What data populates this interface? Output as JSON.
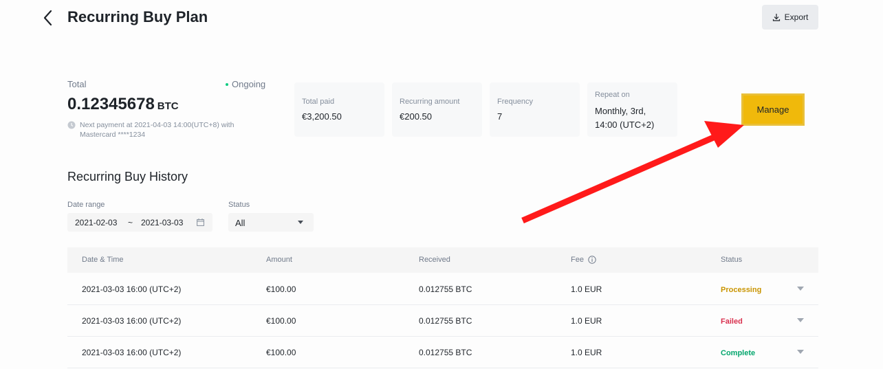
{
  "header": {
    "title": "Recurring Buy Plan",
    "export_label": "Export"
  },
  "plan": {
    "total_label": "Total",
    "status_label": "Ongoing",
    "amount": "0.12345678",
    "unit": "BTC",
    "next_payment": "Next payment at 2021-04-03 14:00(UTC+8) with Mastercard ****1234"
  },
  "cards": [
    {
      "label": "Total paid",
      "value": "€3,200.50"
    },
    {
      "label": "Recurring amount",
      "value": "€200.50"
    },
    {
      "label": "Frequency",
      "value": "7"
    },
    {
      "label": "Repeat on",
      "value": "Monthly, 3rd, 14:00 (UTC+2)"
    }
  ],
  "manage_label": "Manage",
  "history": {
    "title": "Recurring Buy History",
    "date_range_label": "Date range",
    "date_from": "2021-02-03",
    "date_sep": "~",
    "date_to": "2021-03-03",
    "status_label": "Status",
    "status_value": "All"
  },
  "table": {
    "columns": [
      "Date & Time",
      "Amount",
      "Received",
      "Fee",
      "Status"
    ],
    "rows": [
      {
        "datetime": "2021-03-03 16:00 (UTC+2)",
        "amount": "€100.00",
        "received": "0.012755 BTC",
        "fee": "1.0 EUR",
        "status": "Processing"
      },
      {
        "datetime": "2021-03-03 16:00 (UTC+2)",
        "amount": "€100.00",
        "received": "0.012755 BTC",
        "fee": "1.0 EUR",
        "status": "Failed"
      },
      {
        "datetime": "2021-03-03 16:00 (UTC+2)",
        "amount": "€100.00",
        "received": "0.012755 BTC",
        "fee": "1.0 EUR",
        "status": "Complete"
      }
    ]
  },
  "colors": {
    "accent": "#f0b90b",
    "processing": "#c99400",
    "failed": "#d9304e",
    "complete": "#03a66d",
    "ongoing_dot": "#0ecb81",
    "annotation_arrow": "#ff1a1a"
  },
  "icons": [
    "back-arrow-icon",
    "download-icon",
    "clock-icon",
    "calendar-icon",
    "caret-down-icon",
    "info-icon"
  ]
}
